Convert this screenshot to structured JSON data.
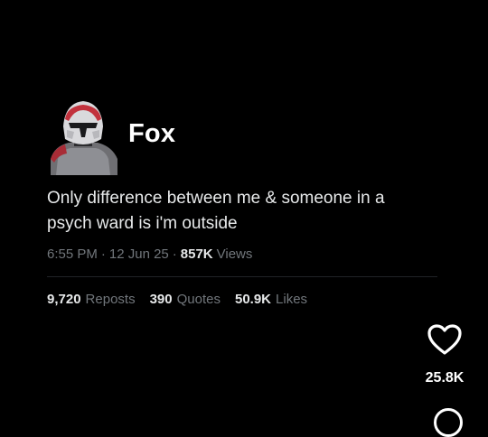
{
  "post": {
    "author": {
      "display_name": "Fox",
      "avatar_icon": "clone-trooper-helmet-avatar"
    },
    "text_line_1": "Only difference between me & someone in a",
    "text_line_2": "psych ward is i'm outside",
    "meta": {
      "time": "6:55 PM",
      "sep1": "·",
      "date": "12 Jun 25",
      "sep2": "·",
      "views_count": "857K",
      "views_label": "Views"
    },
    "stats": {
      "reposts_count": "9,720",
      "reposts_label": "Reposts",
      "quotes_count": "390",
      "quotes_label": "Quotes",
      "likes_count": "50.9K",
      "likes_label": "Likes"
    }
  },
  "side_actions": {
    "heart_icon": "heart-outline-icon",
    "like_count": "25.8K",
    "next_icon": "circle-icon"
  },
  "colors": {
    "background": "#000000",
    "text_primary": "#e7e9ea",
    "text_secondary": "#71767b",
    "divider": "#202327",
    "accent_red": "#c2323d"
  }
}
